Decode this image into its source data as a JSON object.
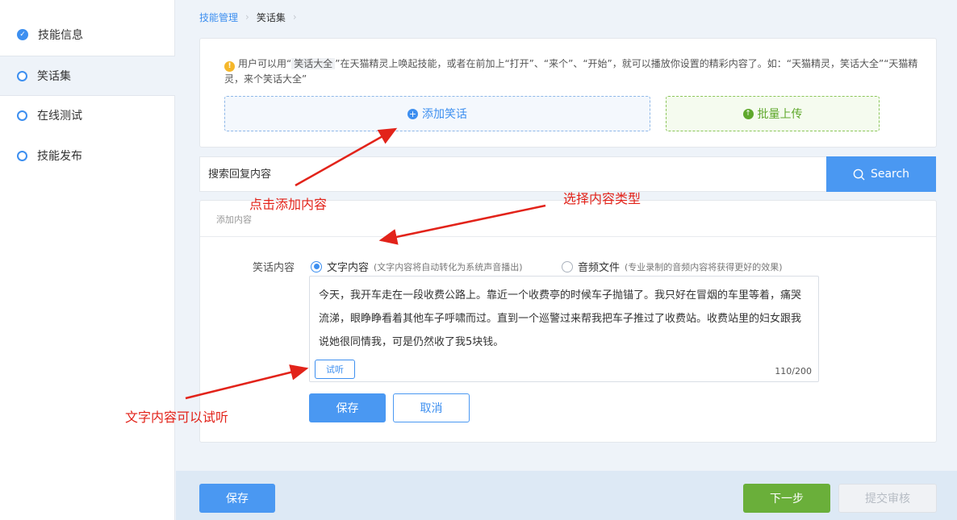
{
  "sidebar": {
    "items": [
      {
        "label": "技能信息",
        "state": "done"
      },
      {
        "label": "笑话集",
        "state": "active"
      },
      {
        "label": "在线测试",
        "state": "todo"
      },
      {
        "label": "技能发布",
        "state": "todo"
      }
    ]
  },
  "breadcrumb": {
    "parent": "技能管理",
    "current": "笑话集"
  },
  "tip": {
    "prefix": "用户可以用“",
    "keyword": "笑话大全",
    "rest": "”在天猫精灵上唤起技能，或者在前加上“打开”、“来个”、“开始”，就可以播放你设置的精彩内容了。如：“天猫精灵，笑话大全”“天猫精灵，来个笑话大全”"
  },
  "actions": {
    "add_label": "添加笑话",
    "upload_label": "批量上传"
  },
  "search": {
    "placeholder": "搜索回复内容",
    "button_label": "Search"
  },
  "add_panel": {
    "title": "添加内容",
    "field_label": "笑话内容",
    "radio_text": {
      "label": "文字内容",
      "hint": "(文字内容将自动转化为系统声音播出)",
      "checked": true
    },
    "radio_audio": {
      "label": "音频文件",
      "hint": "(专业录制的音频内容将获得更好的效果)",
      "checked": false
    },
    "content": "今天，我开车走在一段收费公路上。靠近一个收费亭的时候车子抛锚了。我只好在冒烟的车里等着，痛哭流涕，眼睁睁看着其他车子呼啸而过。直到一个巡警过来帮我把车子推过了收费站。收费站里的妇女跟我说她很同情我，可是仍然收了我5块钱。",
    "listen_label": "试听",
    "counter": "110/200",
    "save_label": "保存",
    "cancel_label": "取消"
  },
  "footer": {
    "save_label": "保存",
    "next_label": "下一步",
    "submit_label": "提交审核"
  },
  "annotations": {
    "click_add": "点击添加内容",
    "choose_type": "选择内容类型",
    "text_listen": "文字内容可以试听"
  },
  "colors": {
    "primary": "#4a98f2",
    "success": "#6aaf3a",
    "annotation": "#e2231a",
    "warning": "#f5b72a"
  }
}
